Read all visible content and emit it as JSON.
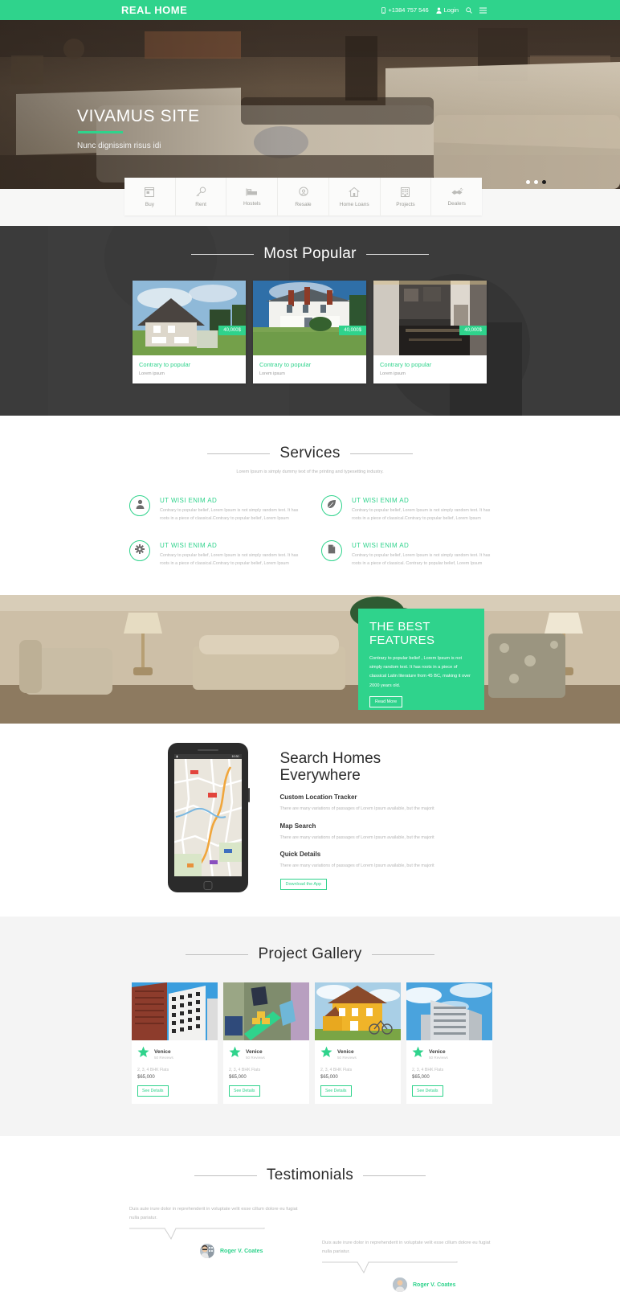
{
  "header": {
    "brand": "REAL HOME",
    "phone": "+1384 757 546",
    "login": "Login",
    "phone_icon": "mobile-icon",
    "user_icon": "user-icon",
    "search_icon": "search-icon",
    "menu_icon": "hamburger-menu-icon"
  },
  "hero": {
    "title": "VIVAMUS SITE",
    "subtitle": "Nunc dignissim risus idi",
    "slides": 3,
    "active_slide": 3
  },
  "categories": [
    {
      "label": "Buy",
      "icon": "store-icon"
    },
    {
      "label": "Rent",
      "icon": "key-icon"
    },
    {
      "label": "Hostels",
      "icon": "bed-icon"
    },
    {
      "label": "Resale",
      "icon": "location-pin-icon"
    },
    {
      "label": "Home Loans",
      "icon": "home-icon"
    },
    {
      "label": "Projects",
      "icon": "building-icon"
    },
    {
      "label": "Dealers",
      "icon": "handshake-icon"
    }
  ],
  "popular": {
    "title": "Most Popular",
    "cards": [
      {
        "price": "40,000$",
        "title": "Contrary to popular",
        "desc": "Lorem ipsum"
      },
      {
        "price": "40,000$",
        "title": "Contrary to popular",
        "desc": "Lorem ipsum"
      },
      {
        "price": "40,000$",
        "title": "Contrary to popular",
        "desc": "Lorem ipsum"
      }
    ]
  },
  "services": {
    "title": "Services",
    "subtitle": "Lorem Ipsum is simply dummy text of the printing and typesetting industry.",
    "items": [
      {
        "icon": "user-icon",
        "title": "UT WISI ENIM AD",
        "text": "Contrary to popular belief, Lorem Ipsum is not simply random text. It has roots in a piece of classical.Contrary to popular belief, Lorem Ipsum"
      },
      {
        "icon": "leaf-icon",
        "title": "UT WISI ENIM AD",
        "text": "Contrary to popular belief, Lorem Ipsum is not simply random text. It has roots in a piece of classical.Contrary to popular belief, Lorem Ipsum"
      },
      {
        "icon": "gear-icon",
        "title": "UT WISI ENIM AD",
        "text": "Contrary to popular belief, Lorem Ipsum is not simply random text. It has roots in a piece of classical.Contrary to popular belief, Lorem Ipsum"
      },
      {
        "icon": "document-icon",
        "title": "UT WISI ENIM AD",
        "text": "Contrary to popular belief, Lorem Ipsum is not simply random text. It has roots in a piece of classical. Contrary to popular belief, Lorem Ipsum"
      }
    ]
  },
  "features": {
    "title": "THE BEST FEATURES",
    "text": "Contrary to popular belief , Lorem Ipsum is not simply random text. It has roots in a piece of classical Latin literature from 45 BC, making it over 2000 years old.",
    "button": "Read More"
  },
  "search": {
    "title": "Search Homes Everywhere",
    "phone_time": "10:30",
    "blocks": [
      {
        "heading": "Custom Location Tracker",
        "text": "There are many variations of passages of Lorem Ipsum available, but the majorit"
      },
      {
        "heading": "Map Search",
        "text": "There are many variations of passages of Lorem Ipsum available, but the majorit"
      },
      {
        "heading": "Quick Details",
        "text": "There are many variations of passages of Lorem Ipsum available, but the majorit"
      }
    ],
    "button": "Download the App"
  },
  "gallery": {
    "title": "Project Gallery",
    "items": [
      {
        "name": "Venice",
        "reviews": "50 Reviews",
        "meta": "2, 3, 4 BHK Flats",
        "price": "$65,000",
        "button": "See Details",
        "icon": "star-icon"
      },
      {
        "name": "Venice",
        "reviews": "50 Reviews",
        "meta": "2, 3, 4 BHK Flats",
        "price": "$65,000",
        "button": "See Details",
        "icon": "star-icon"
      },
      {
        "name": "Venice",
        "reviews": "50 Reviews",
        "meta": "2, 3, 4 BHK Flats",
        "price": "$65,000",
        "button": "See Details",
        "icon": "star-icon"
      },
      {
        "name": "Venice",
        "reviews": "50 Reviews",
        "meta": "2, 3, 4 BHK Flats",
        "price": "$65,000",
        "button": "See Details",
        "icon": "star-icon"
      }
    ]
  },
  "testimonials": {
    "title": "Testimonials",
    "items": [
      {
        "quote": "Duis aute irure dolor in reprehenderit in voluptate velit esse cillum dolore eu fugiat nulla pariatur.",
        "name": "Roger V. Coates"
      },
      {
        "quote": "Duis aute irure dolor in reprehenderit in voluptate velit esse cillum dolore eu fugiat nulla pariatur.",
        "name": "Roger V. Coates"
      }
    ]
  },
  "colors": {
    "accent": "#2fd38c",
    "dark": "#3e3e3e",
    "muted": "#b5b5b5"
  }
}
